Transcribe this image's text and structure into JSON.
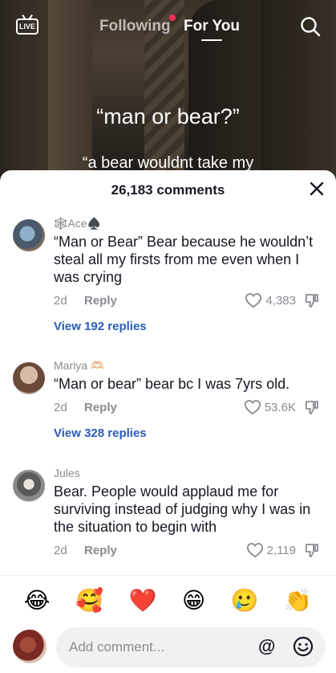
{
  "nav": {
    "live_label": "LIVE",
    "tab_following": "Following",
    "tab_foryou": "For You"
  },
  "video": {
    "overlay_line1": "“man or bear?”",
    "overlay_line2": "“a bear wouldnt take my"
  },
  "comments_sheet": {
    "count_label": "26,183 comments",
    "comments": [
      {
        "user": "🕸️Ace♠️",
        "text": "“Man or Bear” Bear because he wouldn’t steal all my firsts from me even when I was crying",
        "date": "2d",
        "reply_label": "Reply",
        "likes": "4,383",
        "view_replies": "View 192 replies"
      },
      {
        "user": "Mariya 🫶🏻",
        "text": "“Man or bear” bear bc I was 7yrs old.",
        "date": "2d",
        "reply_label": "Reply",
        "likes": "53.6K",
        "view_replies": "View 328 replies"
      },
      {
        "user": "Jules",
        "text": "Bear. People would applaud me for surviving instead of judging why I was in the situation to begin with",
        "date": "2d",
        "reply_label": "Reply",
        "likes": "2,119"
      }
    ]
  },
  "emoji_bar": [
    "😂",
    "🥰",
    "❤️",
    "😁",
    "🥲",
    "👏"
  ],
  "input": {
    "placeholder": "Add comment...",
    "at_symbol": "@"
  },
  "colors": {
    "accent_red": "#fe2c55",
    "link_blue": "#2b5db9",
    "text_dark": "#161823",
    "text_gray": "#8a8b91"
  }
}
